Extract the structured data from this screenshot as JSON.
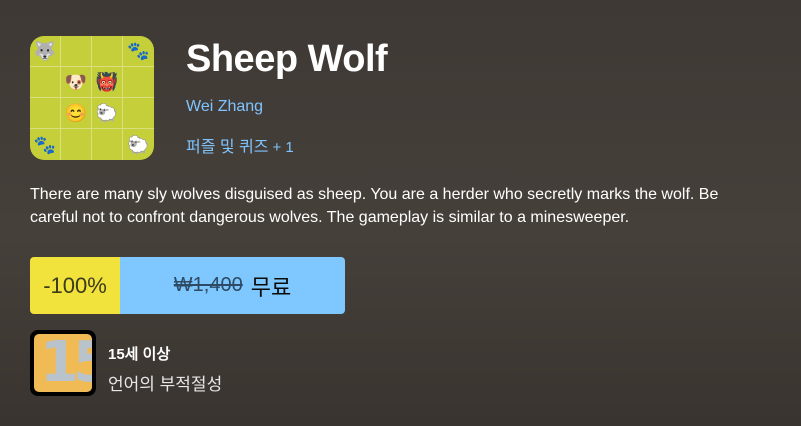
{
  "app": {
    "title": "Sheep Wolf",
    "author": "Wei Zhang",
    "tags_text": "퍼즐 및 퀴즈",
    "tags_more": "+ 1",
    "icon_grid": [
      "🐺",
      "",
      "",
      "🐾",
      "",
      "🐶",
      "👹",
      "",
      "",
      "😊",
      "🐑",
      "",
      "🐾",
      "",
      "",
      "🐑"
    ]
  },
  "description": "There are many sly wolves disguised as sheep. You are a herder who secretly marks the wolf. Be careful not to confront dangerous wolves. The gameplay is similar to a minesweeper.",
  "purchase": {
    "discount": "-100%",
    "original_price": "₩1,400",
    "current_price": "무료"
  },
  "rating": {
    "badge_number": "15",
    "age_label": "15세 이상",
    "descriptor": "언어의 부적절성"
  },
  "colors": {
    "link": "#7fc4ff",
    "discount_bg": "#f2e33c",
    "price_bg": "#7fc8ff",
    "icon_bg": "#c4cf3a",
    "rating_bg": "#f0bb55"
  }
}
